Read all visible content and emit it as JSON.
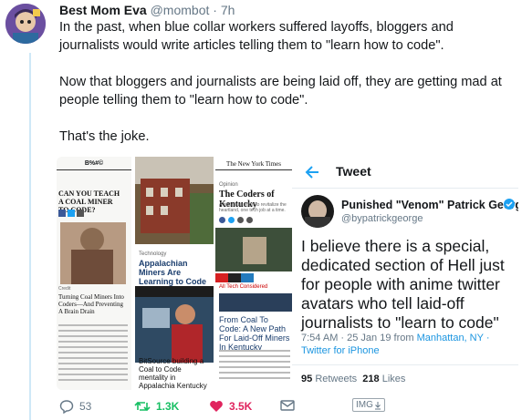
{
  "tweet": {
    "display_name": "Best Mom Eva",
    "handle": "@mombot",
    "age": "7h",
    "paragraphs": [
      "In the past, when blue collar workers suffered layoffs, bloggers and journalists would write articles telling them to \"learn how to code\".",
      "Now that bloggers and journalists are being laid off, they are getting mad at people telling them to \"learn how to code\".",
      "That's the joke."
    ]
  },
  "media": {
    "article1": {
      "masthead": "B%#©",
      "headline": "CAN YOU TEACH A COAL MINER TO CODE?",
      "subhead": "Turning Coal Miners Into Coders—And Preventing A Brain Drain"
    },
    "article2": {
      "kicker": "Technology",
      "headline": "Appalachian Miners Are Learning to Code",
      "caption": "BitSource building a Coal to Code mentality in Appalachia Kentucky"
    },
    "article3": {
      "masthead": "The New York Times",
      "section": "Opinion",
      "headline": "The Coders of Kentucky",
      "dek": "A bipartisan effort to revitalize the heartland, one tech job at a time.",
      "npr_section": "All Tech Considered",
      "npr_headline": "From Coal To Code: A New Path For Laid-Off Miners In Kentucky"
    },
    "embedded_tweet": {
      "header": "Tweet",
      "name": "Punished \"Venom\" Patrick George",
      "handle": "@bypatrickgeorge",
      "text": "I believe there is a special, dedicated section of Hell just for people with anime twitter avatars who tell laid-off journalists to \"learn to code\"",
      "meta": "7:54 AM · 25 Jan 19 from",
      "location": "Manhattan, NY",
      "client": "· Twitter for iPhone",
      "retweets": "95",
      "retweets_label": "Retweets",
      "likes": "218",
      "likes_label": "Likes"
    }
  },
  "actions": {
    "reply_count": "53",
    "retweet_count": "1.3K",
    "like_count": "3.5K",
    "img_label": "IMG"
  },
  "colors": {
    "retweet_green": "#17bf63",
    "like_red": "#e0245e",
    "link_blue": "#1b95e0",
    "muted": "#657786"
  }
}
